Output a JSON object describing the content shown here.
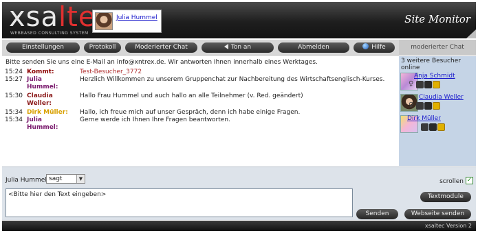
{
  "header": {
    "logo_text_a": "xsa",
    "logo_text_b": "ltec",
    "logo_sub": "WEBBASED CONSULTING SYSTEM",
    "user_name": "Julia Hummel",
    "app_title": "Site Monitor"
  },
  "nav": {
    "settings": "Einstellungen",
    "protocol": "Protokoll",
    "moderated_chat": "Moderierter Chat",
    "sound": "Ton an",
    "logout": "Abmelden",
    "help": "Hilfe"
  },
  "chat": {
    "notice": "Bitte senden Sie uns eine E-Mail an info@xntrex.de. Wir antworten Ihnen innerhalb eines Werktages.",
    "messages": [
      {
        "time": "15:24",
        "who": "Kommt:",
        "text": "Test-Besucher_3772",
        "who_color": "#8b0000",
        "text_color": "#b03030"
      },
      {
        "time": "15:27",
        "who": "Julia Hummel:",
        "text": "Herzlich Willkommen zu unserem Gruppenchat zur Nachbereitung des Wirtschaftsenglisch-Kurses.",
        "who_color": "#7b1b6e",
        "text_color": "#222222"
      },
      {
        "time": "15:30",
        "who": "Claudia Weller:",
        "text": "Hallo Frau Hummel und auch hallo an alle Teilnehmer (v. Red. geändert)",
        "who_color": "#8b1a1a",
        "text_color": "#222222"
      },
      {
        "time": "15:34",
        "who": "Dirk Müller:",
        "text": "Hallo, ich freue mich auf unser Gespräch, denn ich habe einige Fragen.",
        "who_color": "#d8a000",
        "text_color": "#222222"
      },
      {
        "time": "15:34",
        "who": "Julia Hummel:",
        "text": "Gerne werde ich Ihnen Ihre Fragen beantworten.",
        "who_color": "#7b1b6e",
        "text_color": "#222222"
      }
    ]
  },
  "sidebar": {
    "heading": "moderierter Chat",
    "visitors_text": "3 weitere Besucher online",
    "visitors": [
      {
        "name": "Anja Schmidt"
      },
      {
        "name": "Claudia Weller"
      },
      {
        "name": "Dirk Müller"
      }
    ]
  },
  "input": {
    "speaker": "Julia Hummel",
    "verb": "sagt",
    "scroll_label": "scrollen",
    "placeholder": "<Bitte hier den Text eingeben>",
    "send": "Senden",
    "text_modules": "Textmodule",
    "send_website": "Webseite senden"
  },
  "footer": {
    "version": "xsaltec Version 2"
  }
}
